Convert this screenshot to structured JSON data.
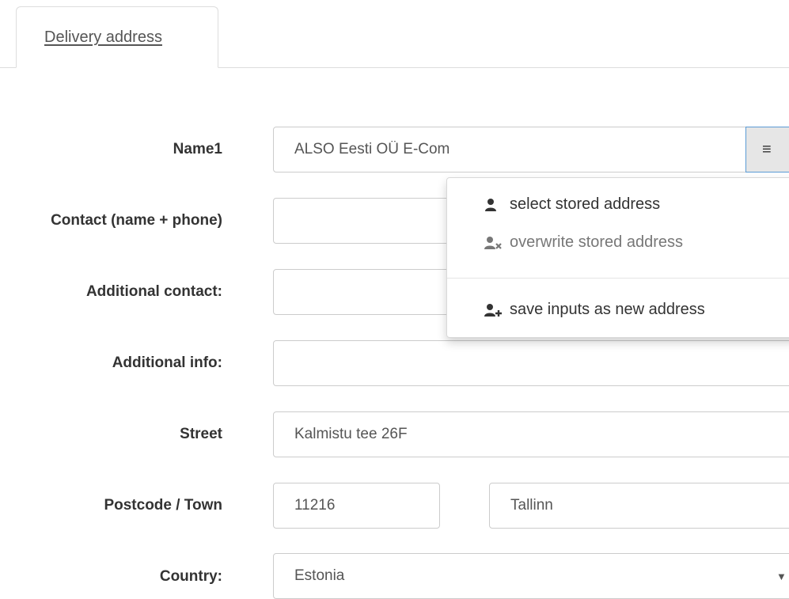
{
  "tabs": [
    {
      "label": "Delivery address"
    }
  ],
  "form": {
    "name1": {
      "label": "Name1",
      "value": "ALSO Eesti OÜ E-Com",
      "menu_icon": "≡"
    },
    "contact": {
      "label": "Contact (name + phone)",
      "value": ""
    },
    "additional_contact": {
      "label": "Additional contact:",
      "value": ""
    },
    "additional_info": {
      "label": "Additional info:",
      "value": ""
    },
    "street": {
      "label": "Street",
      "value": "Kalmistu tee 26F"
    },
    "postcode_town": {
      "label": "Postcode / Town",
      "postcode": "11216",
      "town": "Tallinn"
    },
    "country": {
      "label": "Country:",
      "value": "Estonia",
      "caret": "▼"
    }
  },
  "address_menu": {
    "items": [
      {
        "label": "select stored address",
        "icon": "user-icon",
        "enabled": true
      },
      {
        "label": "overwrite stored address",
        "icon": "user-remove-icon",
        "enabled": false
      },
      {
        "label": "save inputs as new address",
        "icon": "user-add-icon",
        "enabled": true
      }
    ]
  },
  "colors": {
    "enabled_text": "#333333",
    "disabled_text": "#777777",
    "focus_border": "#5b9bd5"
  }
}
